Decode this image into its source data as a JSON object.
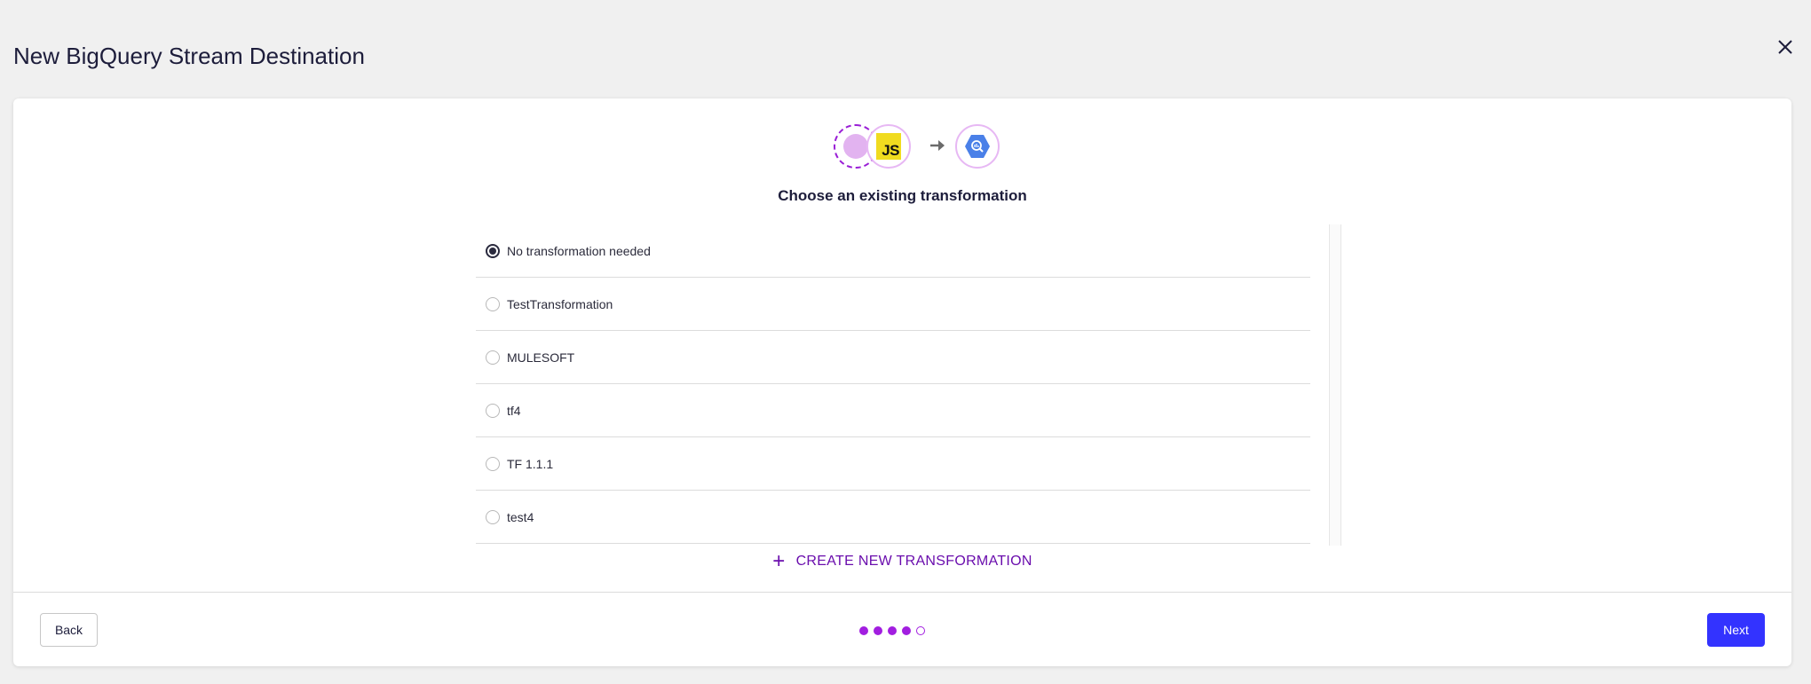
{
  "page": {
    "title": "New BigQuery Stream Destination",
    "close_icon": "close-icon"
  },
  "flow": {
    "source_icon": "source-placeholder-icon",
    "transform_icon": "javascript-icon",
    "transform_badge": "JS",
    "arrow_icon": "arrow-right-icon",
    "destination_icon": "bigquery-icon"
  },
  "main": {
    "subtitle": "Choose an existing transformation",
    "options": [
      {
        "label": "No transformation needed",
        "selected": true
      },
      {
        "label": "TestTransformation",
        "selected": false
      },
      {
        "label": "MULESOFT",
        "selected": false
      },
      {
        "label": "tf4",
        "selected": false
      },
      {
        "label": "TF 1.1.1",
        "selected": false
      },
      {
        "label": "test4",
        "selected": false
      }
    ],
    "create_label": "CREATE NEW TRANSFORMATION"
  },
  "footer": {
    "back_label": "Back",
    "next_label": "Next",
    "steps_total": 5,
    "steps_completed": 4
  },
  "colors": {
    "accent_purple": "#a21ee0",
    "link_purple": "#6a0dad",
    "primary_button": "#3333ff",
    "bigquery_blue": "#4a80e8",
    "js_yellow": "#f0db1f"
  }
}
